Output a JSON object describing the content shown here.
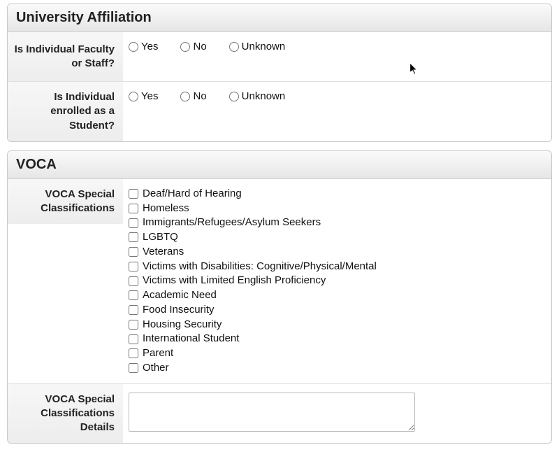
{
  "section1": {
    "title": "University Affiliation",
    "q1": {
      "label": "Is Individual Faculty or Staff?",
      "options": {
        "yes": "Yes",
        "no": "No",
        "unknown": "Unknown"
      }
    },
    "q2": {
      "label": "Is Individual enrolled as a Student?",
      "options": {
        "yes": "Yes",
        "no": "No",
        "unknown": "Unknown"
      }
    }
  },
  "section2": {
    "title": "VOCA",
    "classifications": {
      "label": "VOCA Special Classifications",
      "options": [
        "Deaf/Hard of Hearing",
        "Homeless",
        "Immigrants/Refugees/Asylum Seekers",
        "LGBTQ",
        "Veterans",
        "Victims with Disabilities: Cognitive/Physical/Mental",
        "Victims with Limited English Proficiency",
        "Academic Need",
        "Food Insecurity",
        "Housing Security",
        "International Student",
        "Parent",
        "Other"
      ]
    },
    "details": {
      "label": "VOCA Special Classifications Details",
      "value": ""
    }
  }
}
